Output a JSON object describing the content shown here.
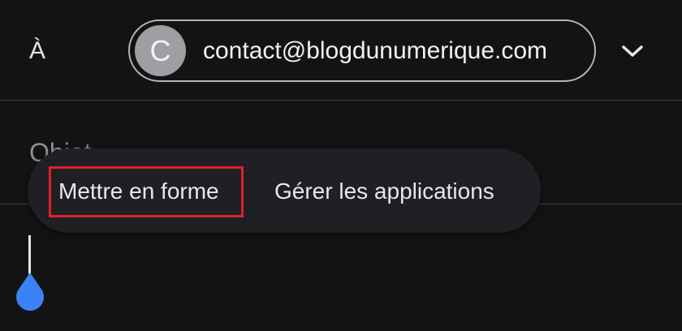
{
  "compose": {
    "to_label": "À",
    "recipient": {
      "avatar_letter": "C",
      "email": "contact@blogdunumerique.com"
    },
    "expand_icon": "chevron-down-icon",
    "subject_placeholder": "Objet"
  },
  "context_menu": {
    "items": [
      {
        "label": "Mettre en forme",
        "highlighted": true
      },
      {
        "label": "Gérer les applications",
        "highlighted": false
      }
    ]
  },
  "colors": {
    "background": "#131314",
    "menu_background": "#1f2024",
    "highlight": "#e0202a",
    "avatar": "#9f9fa3",
    "cursor_handle": "#3b82f6"
  }
}
